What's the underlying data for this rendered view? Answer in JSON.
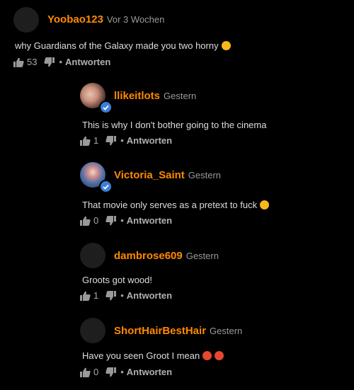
{
  "comments": [
    {
      "username": "Yoobao123",
      "time": "Vor 3 Wochen",
      "text": "why Guardians of the Galaxy made you two horny",
      "emoji": [
        "grinning-squinting-emoji"
      ],
      "likes": "53",
      "reply_label": "Antworten"
    },
    {
      "username": "llikeitlots",
      "time": "Gestern",
      "text": "This is why I don't bother going to the cinema",
      "likes": "1",
      "reply_label": "Antworten"
    },
    {
      "username": "Victoria_Saint",
      "time": "Gestern",
      "text": "That movie only serves as a pretext to fuck",
      "emoji": [
        "smirking-emoji"
      ],
      "likes": "0",
      "reply_label": "Antworten"
    },
    {
      "username": "dambrose609",
      "time": "Gestern",
      "text": "Groots got wood!",
      "likes": "1",
      "reply_label": "Antworten"
    },
    {
      "username": "ShortHairBestHair",
      "time": "Gestern",
      "text": "Have you seen Groot I mean",
      "emoji": [
        "exploding-head-emoji",
        "exploding-head-emoji"
      ],
      "likes": "0",
      "reply_label": "Antworten"
    }
  ],
  "colors": {
    "username": "#ff8a00",
    "verified": "#3b7fd9",
    "background": "#000000"
  }
}
